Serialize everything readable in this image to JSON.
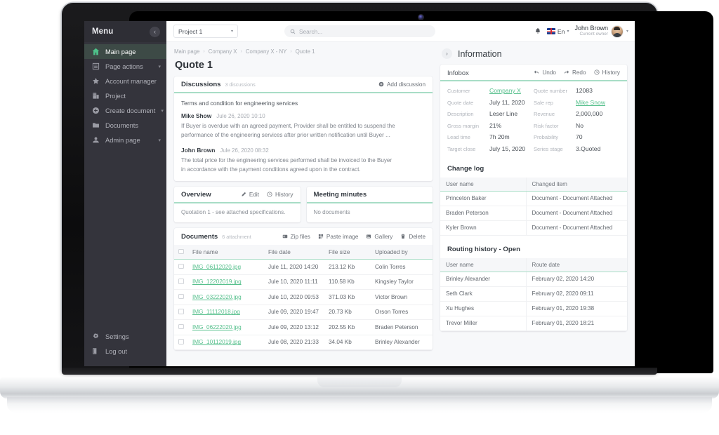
{
  "sidebar": {
    "title": "Menu",
    "collapse_icon": "chevron-left-icon",
    "items": [
      {
        "label": "Main page",
        "icon": "home-icon",
        "active": true,
        "caret": false
      },
      {
        "label": "Page actions",
        "icon": "list-icon",
        "active": false,
        "caret": true
      },
      {
        "label": "Account manager",
        "icon": "star-icon",
        "active": false,
        "caret": false
      },
      {
        "label": "Project",
        "icon": "building-icon",
        "active": false,
        "caret": false
      },
      {
        "label": "Create document",
        "icon": "plus-circle-icon",
        "active": false,
        "caret": true
      },
      {
        "label": "Documents",
        "icon": "folder-icon",
        "active": false,
        "caret": false
      },
      {
        "label": "Admin page",
        "icon": "user-icon",
        "active": false,
        "caret": true
      }
    ],
    "footer": [
      {
        "label": "Settings",
        "icon": "gear-icon"
      },
      {
        "label": "Log out",
        "icon": "logout-icon"
      }
    ]
  },
  "topbar": {
    "project_select": "Project 1",
    "search_placeholder": "Search...",
    "bell_icon": "bell-icon",
    "language": "En",
    "flag_icon": "uk-flag-icon",
    "user_name": "John Brown",
    "user_role": "Current owner"
  },
  "breadcrumb": [
    "Main page",
    "Company X",
    "Company X - NY",
    "Quote 1"
  ],
  "page_title": "Quote 1",
  "discussions": {
    "title": "Discussions",
    "count_label": "3 discussions",
    "add_label": "Add discussion",
    "subject": "Terms and condition for engineering services",
    "posts": [
      {
        "author": "Mike Show",
        "date": "Jule 26, 2020 10:10",
        "line1": "If Buyer is overdue with an agreed payment, Provider shall be entitled to suspend the",
        "line2": "performance of the engineering services after prior written notification until Buyer ..."
      },
      {
        "author": "John Brown",
        "date": "Jule 26, 2020 08:32",
        "line1": "The total price for the engineering services performed shall be invoiced to the Buyer",
        "line2": "in accordance with the payment conditions agreed upon in the contract."
      }
    ]
  },
  "overview": {
    "title": "Overview",
    "edit_label": "Edit",
    "history_label": "History",
    "body": "Quotation 1 - see attached specifications."
  },
  "meeting_minutes": {
    "title": "Meeting minutes",
    "body": "No documents"
  },
  "documents": {
    "title": "Documents",
    "count_label": "6 attachment",
    "actions": [
      {
        "label": "Zip files",
        "icon": "zip-icon"
      },
      {
        "label": "Paste image",
        "icon": "paste-image-icon"
      },
      {
        "label": "Gallery",
        "icon": "gallery-icon"
      },
      {
        "label": "Delete",
        "icon": "trash-icon"
      }
    ],
    "columns": [
      "File name",
      "File date",
      "File size",
      "Uploaded by"
    ],
    "rows": [
      {
        "name": "IMG_06112020.jpg",
        "date": "Jule 11, 2020 14:20",
        "size": "213.12 Kb",
        "by": "Colin Torres"
      },
      {
        "name": "IMG_12202019.jpg",
        "date": "Jule 10, 2020 11:11",
        "size": "110.58 Kb",
        "by": "Kingsley Taylor"
      },
      {
        "name": "IMG_03222020.jpg",
        "date": "Jule 10, 2020 09:53",
        "size": "371.03 Kb",
        "by": "Victor Brown"
      },
      {
        "name": "IMG_11112018.jpg",
        "date": "Jule 09, 2020 19:47",
        "size": "20.73 Kb",
        "by": "Orson Torres"
      },
      {
        "name": "IMG_06222020.jpg",
        "date": "Jule 09, 2020 13:12",
        "size": "202.55 Kb",
        "by": "Braden Peterson"
      },
      {
        "name": "IMG_10112019.jpg",
        "date": "Jule 08, 2020 21:33",
        "size": "34.04 Kb",
        "by": "Brinley Alexander"
      }
    ]
  },
  "information": {
    "title": "Information",
    "chevron_icon": "chevron-right-icon",
    "infobox": {
      "title": "Infobox",
      "actions": [
        {
          "label": "Undo",
          "icon": "undo-icon"
        },
        {
          "label": "Redo",
          "icon": "redo-icon"
        },
        {
          "label": "History",
          "icon": "history-icon"
        }
      ],
      "left": [
        {
          "key": "Customer",
          "value": "Company X",
          "link": true
        },
        {
          "key": "Quote date",
          "value": "July 11, 2020",
          "link": false
        },
        {
          "key": "Description",
          "value": "Leser Line",
          "link": false
        },
        {
          "key": "Gross margin",
          "value": "21%",
          "link": false
        },
        {
          "key": "Lead time",
          "value": "7h 20m",
          "link": false
        },
        {
          "key": "Target close",
          "value": "July 15, 2020",
          "link": false
        }
      ],
      "right": [
        {
          "key": "Quote number",
          "value": "12083",
          "link": false
        },
        {
          "key": "Sale rep",
          "value": "Mike Snow",
          "link": true
        },
        {
          "key": "Revenue",
          "value": "2,000,000",
          "link": false
        },
        {
          "key": "Risk factor",
          "value": "No",
          "link": false
        },
        {
          "key": "Probability",
          "value": "70",
          "link": false
        },
        {
          "key": "Series stage",
          "value": "3.Quoted",
          "link": false
        }
      ]
    },
    "change_log": {
      "title": "Change log",
      "columns": [
        "User name",
        "Changed item"
      ],
      "rows": [
        {
          "user": "Princeton Baker",
          "item": "Document - Document Attached"
        },
        {
          "user": "Braden Peterson",
          "item": "Document - Document Attached"
        },
        {
          "user": "Kyler Brown",
          "item": "Document - Document Attached"
        }
      ]
    },
    "routing_history": {
      "title": "Routing history - Open",
      "columns": [
        "User name",
        "Route date"
      ],
      "rows": [
        {
          "user": "Brinley Alexander",
          "date": "February 02, 2020 14:20"
        },
        {
          "user": "Seth Clark",
          "date": "February 02, 2020 09:11"
        },
        {
          "user": "Xu Hughes",
          "date": "February 01, 2020 19:38"
        },
        {
          "user": "Trevor Miller",
          "date": "February 01, 2020 18:21"
        }
      ]
    }
  },
  "colors": {
    "accent": "#57c08d",
    "underline": "#a8ddc6",
    "sidebar": "#34343c"
  }
}
